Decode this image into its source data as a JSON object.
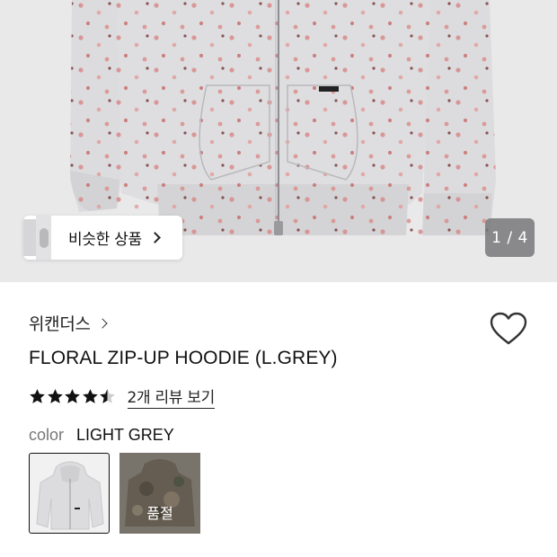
{
  "gallery": {
    "similar_label": "비슷한 상품",
    "counter": "1 / 4"
  },
  "product": {
    "brand": "위캔더스",
    "name": "FLORAL ZIP-UP HOODIE (L.GREY)",
    "rating": 4.5,
    "review_link": "2개 리뷰 보기",
    "color_label": "color",
    "color_value": "LIGHT GREY",
    "wishlisted": false
  },
  "color_options": [
    {
      "name": "LIGHT GREY",
      "selected": true,
      "sold_out_label": ""
    },
    {
      "name": "camo",
      "selected": false,
      "sold_out_label": "품절"
    }
  ],
  "colors": {
    "hero_bg": "#e9e9ea",
    "hoodie": "#dcdcde",
    "floral": "#c97a7a",
    "star": "#111111",
    "star_empty": "#cccccc"
  },
  "icons": {
    "similar": "chevron-right-icon",
    "brand": "chevron-right-icon",
    "wishlist": "heart-outline-icon",
    "rating": "star-icon"
  }
}
